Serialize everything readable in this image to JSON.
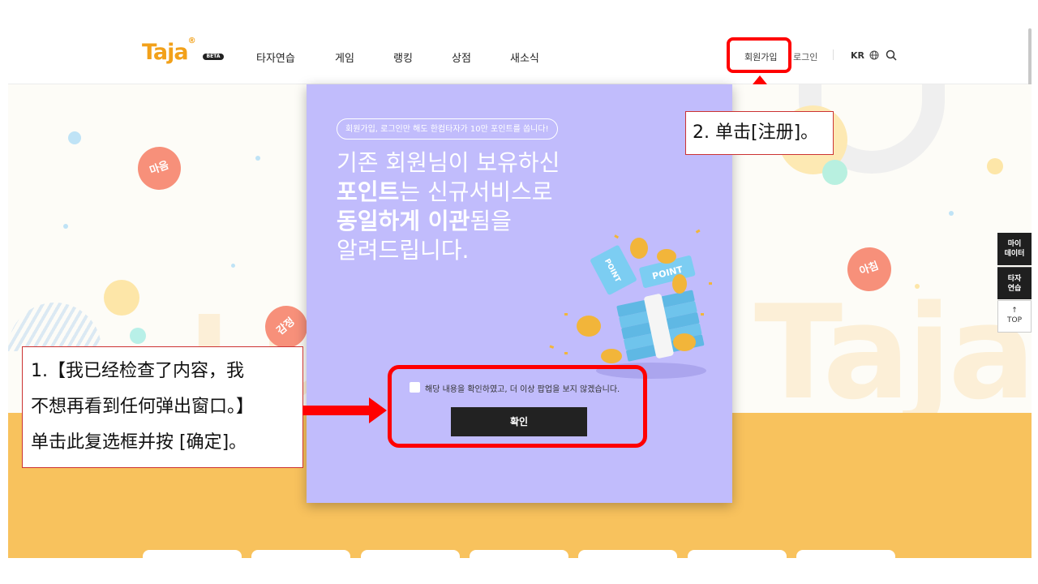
{
  "header": {
    "logo": "Taja",
    "logo_mark": "®",
    "beta_badge": "BETA",
    "nav": [
      "타자연습",
      "게임",
      "랭킹",
      "상점",
      "새소식"
    ],
    "signup": "회원가입",
    "login": "로그인",
    "language": "KR"
  },
  "hero": {
    "bubbles": [
      "마음",
      "감정",
      "아침"
    ],
    "watermark": "Taja",
    "watermark_left": "Lu"
  },
  "side_tabs": {
    "mydata": "마이\n데이터",
    "typing": "타자\n연습",
    "top_arrow": "↑",
    "top": "TOP"
  },
  "popup": {
    "pill": "회원가입, 로그인만 해도 한컴타자가 10만 포인트를 쏩니다!",
    "line1": "기존 회원님이 보유하신",
    "line2_bold": "포인트",
    "line2_rest": "는 신규서비스로",
    "line3_bold": "동일하게 이관",
    "line3_rest": "됨을",
    "line4": "알려드립니다.",
    "coin_label_1": "POINT",
    "coin_label_2": "POINT",
    "checkbox_label": "해당 내용을 확인하였고, 더 이상 팝업을 보지 않겠습니다.",
    "confirm_button": "확인"
  },
  "section": {
    "heading_cut": "-"
  },
  "annotations": {
    "step1": [
      "1.【我已经检查了内容，我",
      "不想再看到任何弹出窗口。】",
      "单击此复选框并按 [确定]。"
    ],
    "step2": "2. 单击[注册]。"
  },
  "colors": {
    "popup_bg": "#c1bcfc",
    "accent_orange": "#f2a11a",
    "yellow_band": "#f8c25d",
    "highlight_red": "#ff0000"
  }
}
